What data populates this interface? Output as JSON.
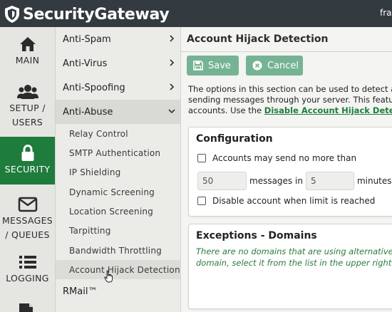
{
  "app": {
    "brand": "SecurityGateway",
    "user_fragment": "fra"
  },
  "nav": [
    {
      "id": "main",
      "label": "MAIN",
      "icon": "home-icon",
      "active": false
    },
    {
      "id": "setup",
      "label": "SETUP /\nUSERS",
      "icon": "users-icon",
      "active": false
    },
    {
      "id": "security",
      "label": "SECURITY",
      "icon": "lock-icon",
      "active": true
    },
    {
      "id": "messages",
      "label": "MESSAGES\n/ QUEUES",
      "icon": "envelope-icon",
      "active": false
    },
    {
      "id": "logging",
      "label": "LOGGING",
      "icon": "list-icon",
      "active": false
    }
  ],
  "submenu": {
    "sections": [
      "Anti-Spam",
      "Anti-Virus",
      "Anti-Spoofing",
      "Anti-Abuse"
    ],
    "expanded": "Anti-Abuse",
    "items": [
      "Relay Control",
      "SMTP Authentication",
      "IP Shielding",
      "Dynamic Screening",
      "Location Screening",
      "Tarpitting",
      "Bandwidth Throttling",
      "Account Hijack Detection"
    ],
    "selected": "Account Hijack Detection",
    "after": "RMail™"
  },
  "page": {
    "title": "Account Hijack Detection",
    "save_label": "Save",
    "cancel_label": "Cancel",
    "intro_line1": "The options in this section can be used to detect and",
    "intro_line2": "sending messages through your server. This feature",
    "intro_line3_prefix": "accounts. Use the ",
    "intro_link": "Disable Account Hijack Detection"
  },
  "configuration": {
    "title": "Configuration",
    "limit_label": "Accounts may send no more than",
    "limit_checked": false,
    "messages_value": "50",
    "messages_label": "messages in",
    "minutes_value": "5",
    "minutes_label": "minutes",
    "disable_label": "Disable account when limit is reached",
    "disable_checked": false
  },
  "exceptions": {
    "title": "Exceptions - Domains",
    "notice_line1": "There are no domains that are using alternative",
    "notice_line2": "domain, select it from the list in the upper right"
  },
  "colors": {
    "topbar": "#333a40",
    "active_nav": "#1e7c3c",
    "button": "#76b394",
    "link": "#1e7c3c"
  }
}
